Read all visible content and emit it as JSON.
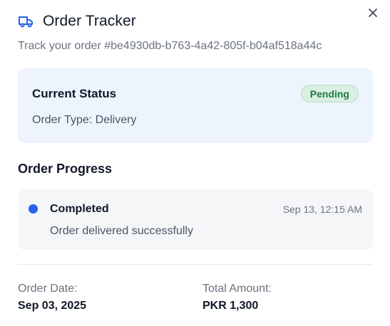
{
  "header": {
    "title": "Order Tracker",
    "icon": "truck-icon",
    "accent_color": "#2463eb",
    "close_icon": "close-icon"
  },
  "subtitle": "Track your order #be4930db-b763-4a42-805f-b04af518a44c",
  "status": {
    "title": "Current Status",
    "badge": "Pending",
    "badge_color": "#1c7a44",
    "order_type": "Order Type: Delivery"
  },
  "progress": {
    "heading": "Order Progress",
    "steps": [
      {
        "title": "Completed",
        "time": "Sep 13, 12:15 AM",
        "description": "Order delivered successfully"
      }
    ]
  },
  "summary": {
    "order_date_label": "Order Date:",
    "order_date": "Sep 03, 2025",
    "total_label": "Total Amount:",
    "total": "PKR 1,300"
  }
}
